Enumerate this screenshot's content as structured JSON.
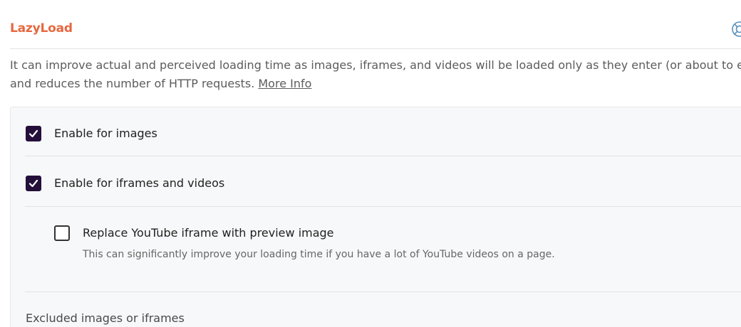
{
  "section": {
    "title": "LazyLoad",
    "help_icon": "lifebuoy-icon",
    "description": "It can improve actual and perceived loading time as images, iframes, and videos will be loaded only as they enter (or about to enter) t",
    "description_line2": "and reduces the number of HTTP requests.",
    "more_info_label": "More Info"
  },
  "options": {
    "images": {
      "label": "Enable for images",
      "checked": true
    },
    "iframes": {
      "label": "Enable for iframes and videos",
      "checked": true
    },
    "youtube": {
      "label": "Replace YouTube iframe with preview image",
      "help": "This can significantly improve your loading time if you have a lot of YouTube videos on a page.",
      "checked": false
    }
  },
  "excluded": {
    "label": "Excluded images or iframes"
  },
  "colors": {
    "accent": "#e8673f",
    "checkbox": "#240f3a",
    "panel_bg": "#f7f8f9"
  }
}
